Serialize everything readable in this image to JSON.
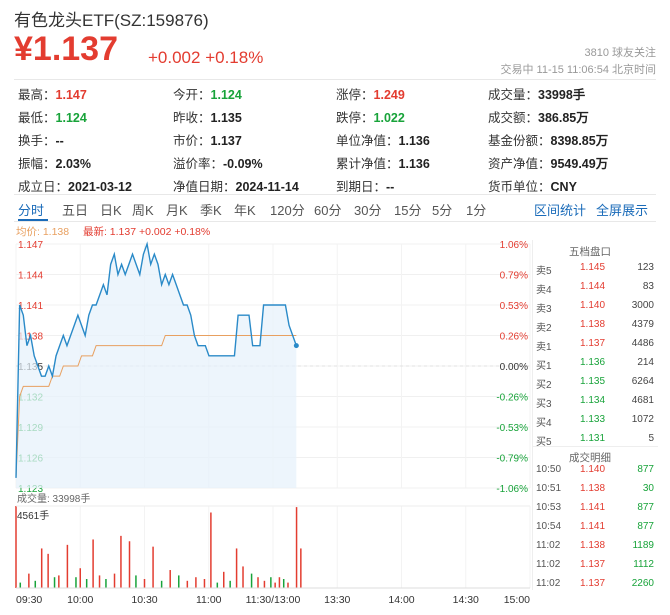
{
  "header": {
    "title": "有色龙头ETF(SZ:159876)",
    "price": "¥1.137",
    "change": "+0.002  +0.18%",
    "followers": "3810  球友关注",
    "status_time": "交易中  11-15 11:06:54  北京时间"
  },
  "stats": [
    [
      {
        "label": "最高：",
        "value": "1.147",
        "color": "red"
      },
      {
        "label": "今开：",
        "value": "1.124",
        "color": "grn"
      },
      {
        "label": "涨停：",
        "value": "1.249",
        "color": "red"
      },
      {
        "label": "成交量：",
        "value": "33998手",
        "color": ""
      }
    ],
    [
      {
        "label": "最低：",
        "value": "1.124",
        "color": "grn"
      },
      {
        "label": "昨收：",
        "value": "1.135",
        "color": ""
      },
      {
        "label": "跌停：",
        "value": "1.022",
        "color": "grn"
      },
      {
        "label": "成交额：",
        "value": "386.85万",
        "color": ""
      }
    ],
    [
      {
        "label": "换手：",
        "value": "--",
        "color": ""
      },
      {
        "label": "市价：",
        "value": "1.137",
        "color": ""
      },
      {
        "label": "单位净值：",
        "value": "1.136",
        "color": ""
      },
      {
        "label": "基金份额：",
        "value": "8398.85万",
        "color": ""
      }
    ],
    [
      {
        "label": "振幅：",
        "value": "2.03%",
        "color": ""
      },
      {
        "label": "溢价率：",
        "value": "-0.09%",
        "color": ""
      },
      {
        "label": "累计净值：",
        "value": "1.136",
        "color": ""
      },
      {
        "label": "资产净值：",
        "value": "9549.49万",
        "color": ""
      }
    ],
    [
      {
        "label": "成立日：",
        "value": "2021-03-12",
        "color": ""
      },
      {
        "label": "净值日期：",
        "value": "2024-11-14",
        "color": ""
      },
      {
        "label": "到期日：",
        "value": "--",
        "color": ""
      },
      {
        "label": "货币单位：",
        "value": "CNY",
        "color": ""
      }
    ]
  ],
  "tabs": [
    "分时",
    "五日",
    "日K",
    "周K",
    "月K",
    "季K",
    "年K",
    "120分",
    "60分",
    "30分",
    "15分",
    "5分",
    "1分"
  ],
  "tabs_right": [
    "区间统计",
    "全屏展示"
  ],
  "legend": {
    "avg": "均价: 1.138",
    "latest": "最新: 1.137  +0.002  +0.18%"
  },
  "colors": {
    "up": "#e33c30",
    "down": "#18a33a",
    "line": "#2a8ac8",
    "avg": "#e8a060",
    "accent": "#1a6bb9"
  },
  "chart_data": {
    "type": "line",
    "x_ticks": [
      "09:30",
      "10:00",
      "10:30",
      "11:00",
      "11:30/13:00",
      "13:30",
      "14:00",
      "14:30",
      "15:00"
    ],
    "y_left_ticks": [
      "1.147",
      "1.144",
      "1.141",
      "1.138",
      "1.135",
      "1.132",
      "1.129",
      "1.126",
      "1.123"
    ],
    "y_right_ticks": [
      "1.06%",
      "0.79%",
      "0.53%",
      "0.26%",
      "0.00%",
      "-0.26%",
      "-0.53%",
      "-0.79%",
      "-1.06%"
    ],
    "ylim": [
      1.123,
      1.147
    ],
    "total_minutes": 240,
    "price": [
      1.124,
      1.141,
      1.14,
      1.137,
      1.138,
      1.136,
      1.135,
      1.134,
      1.134,
      1.135,
      1.134,
      1.136,
      1.137,
      1.138,
      1.137,
      1.138,
      1.139,
      1.14,
      1.139,
      1.138,
      1.14,
      1.141,
      1.141,
      1.142,
      1.143,
      1.142,
      1.145,
      1.146,
      1.144,
      1.145,
      1.144,
      1.145,
      1.146,
      1.145,
      1.144,
      1.146,
      1.147,
      1.145,
      1.146,
      1.145,
      1.143,
      1.144,
      1.143,
      1.144,
      1.143,
      1.142,
      1.141,
      1.141,
      1.14,
      1.138,
      1.137,
      1.137,
      1.137,
      1.136,
      1.136,
      1.136,
      1.136,
      1.136,
      1.136,
      1.136,
      1.136,
      1.14,
      1.14,
      1.14,
      1.14,
      1.137,
      1.137,
      1.137,
      1.141,
      1.141,
      1.141,
      1.141,
      1.141,
      1.141,
      1.141,
      1.139,
      1.138,
      1.137
    ],
    "avg": [
      1.124,
      1.132,
      1.133,
      1.133,
      1.133,
      1.133,
      1.133,
      1.133,
      1.133,
      1.133,
      1.134,
      1.134,
      1.134,
      1.135,
      1.135,
      1.135,
      1.135,
      1.135,
      1.136,
      1.136,
      1.136,
      1.136,
      1.137,
      1.137,
      1.137,
      1.137,
      1.137,
      1.137,
      1.137,
      1.137,
      1.137,
      1.137,
      1.137,
      1.137,
      1.137,
      1.137,
      1.137,
      1.137,
      1.137,
      1.137,
      1.137,
      1.138,
      1.138,
      1.138,
      1.138,
      1.138,
      1.138,
      1.138,
      1.138,
      1.138,
      1.138,
      1.138,
      1.138,
      1.138,
      1.138,
      1.138,
      1.138,
      1.138,
      1.138,
      1.138,
      1.138,
      1.138,
      1.138,
      1.138,
      1.138,
      1.138,
      1.138,
      1.138,
      1.138,
      1.138,
      1.138,
      1.138,
      1.138,
      1.138,
      1.138,
      1.138,
      1.138,
      1.138
    ],
    "volume_label": "成交量: 33998手",
    "volume_max_label": "4561手",
    "volume_max": 4561,
    "volume": [
      {
        "m": 0,
        "v": 4561,
        "c": "up"
      },
      {
        "m": 2,
        "v": 300,
        "c": "down"
      },
      {
        "m": 6,
        "v": 800,
        "c": "up"
      },
      {
        "m": 9,
        "v": 400,
        "c": "down"
      },
      {
        "m": 12,
        "v": 2200,
        "c": "up"
      },
      {
        "m": 15,
        "v": 1900,
        "c": "up"
      },
      {
        "m": 18,
        "v": 600,
        "c": "down"
      },
      {
        "m": 20,
        "v": 700,
        "c": "up"
      },
      {
        "m": 24,
        "v": 2400,
        "c": "up"
      },
      {
        "m": 28,
        "v": 600,
        "c": "down"
      },
      {
        "m": 30,
        "v": 1100,
        "c": "up"
      },
      {
        "m": 33,
        "v": 500,
        "c": "down"
      },
      {
        "m": 36,
        "v": 2700,
        "c": "up"
      },
      {
        "m": 39,
        "v": 700,
        "c": "up"
      },
      {
        "m": 42,
        "v": 500,
        "c": "down"
      },
      {
        "m": 46,
        "v": 800,
        "c": "up"
      },
      {
        "m": 49,
        "v": 2900,
        "c": "up"
      },
      {
        "m": 53,
        "v": 2600,
        "c": "up"
      },
      {
        "m": 56,
        "v": 700,
        "c": "down"
      },
      {
        "m": 60,
        "v": 500,
        "c": "up"
      },
      {
        "m": 64,
        "v": 2300,
        "c": "up"
      },
      {
        "m": 68,
        "v": 400,
        "c": "down"
      },
      {
        "m": 72,
        "v": 1000,
        "c": "up"
      },
      {
        "m": 76,
        "v": 700,
        "c": "down"
      },
      {
        "m": 80,
        "v": 400,
        "c": "up"
      },
      {
        "m": 84,
        "v": 600,
        "c": "up"
      },
      {
        "m": 88,
        "v": 500,
        "c": "up"
      },
      {
        "m": 91,
        "v": 4200,
        "c": "up"
      },
      {
        "m": 94,
        "v": 300,
        "c": "down"
      },
      {
        "m": 97,
        "v": 900,
        "c": "up"
      },
      {
        "m": 100,
        "v": 400,
        "c": "down"
      },
      {
        "m": 103,
        "v": 2200,
        "c": "up"
      },
      {
        "m": 106,
        "v": 1200,
        "c": "up"
      },
      {
        "m": 110,
        "v": 800,
        "c": "down"
      },
      {
        "m": 113,
        "v": 600,
        "c": "up"
      },
      {
        "m": 116,
        "v": 400,
        "c": "up"
      },
      {
        "m": 119,
        "v": 600,
        "c": "down"
      },
      {
        "m": 121,
        "v": 300,
        "c": "up"
      },
      {
        "m": 123,
        "v": 600,
        "c": "up"
      },
      {
        "m": 125,
        "v": 500,
        "c": "down"
      },
      {
        "m": 127,
        "v": 300,
        "c": "up"
      },
      {
        "m": 131,
        "v": 4500,
        "c": "up"
      },
      {
        "m": 133,
        "v": 2200,
        "c": "up"
      }
    ]
  },
  "orderbook": {
    "title": "五档盘口",
    "rows": [
      {
        "label": "卖5",
        "price": "1.145",
        "vol": "123",
        "color": "up"
      },
      {
        "label": "卖4",
        "price": "1.144",
        "vol": "83",
        "color": "up"
      },
      {
        "label": "卖3",
        "price": "1.140",
        "vol": "3000",
        "color": "up"
      },
      {
        "label": "卖2",
        "price": "1.138",
        "vol": "4379",
        "color": "up"
      },
      {
        "label": "卖1",
        "price": "1.137",
        "vol": "4486",
        "color": "up"
      },
      {
        "label": "买1",
        "price": "1.136",
        "vol": "214",
        "color": "down"
      },
      {
        "label": "买2",
        "price": "1.135",
        "vol": "6264",
        "color": "down"
      },
      {
        "label": "买3",
        "price": "1.134",
        "vol": "4681",
        "color": "down"
      },
      {
        "label": "买4",
        "price": "1.133",
        "vol": "1072",
        "color": "down"
      },
      {
        "label": "买5",
        "price": "1.131",
        "vol": "5",
        "color": "down"
      }
    ],
    "deals_title": "成交明细",
    "deals": [
      {
        "time": "10:50",
        "price": "1.140",
        "vol": "877"
      },
      {
        "time": "10:51",
        "price": "1.138",
        "vol": "30"
      },
      {
        "time": "10:53",
        "price": "1.141",
        "vol": "877"
      },
      {
        "time": "10:54",
        "price": "1.141",
        "vol": "877"
      },
      {
        "time": "11:02",
        "price": "1.138",
        "vol": "1189"
      },
      {
        "time": "11:02",
        "price": "1.137",
        "vol": "1112"
      },
      {
        "time": "11:02",
        "price": "1.137",
        "vol": "2260"
      }
    ]
  }
}
